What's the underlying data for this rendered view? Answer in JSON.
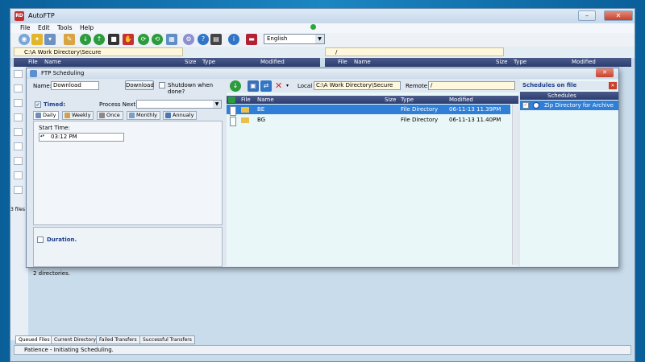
{
  "app": {
    "title": "AutoFTP",
    "icon_text": "RD"
  },
  "window_controls": {
    "minimize": "–",
    "maximize": "□",
    "close": "✕"
  },
  "menu": [
    "File",
    "Edit",
    "Tools",
    "Help"
  ],
  "language": {
    "selected": "English"
  },
  "paths": {
    "local": "C:\\A Work Directory\\Secure",
    "remote": "/"
  },
  "main_columns": {
    "left": [
      "File",
      "Name",
      "Size",
      "Type",
      "Modified"
    ],
    "right": [
      "File",
      "Name",
      "Size",
      "Type",
      "Modified"
    ]
  },
  "file_count": "3 files",
  "ftp": {
    "title": "FTP Scheduling",
    "name_label": "Name:",
    "name_value": "Download",
    "name_button": "Download",
    "shutdown_label": "Shutdown when done?",
    "timed_label": "Timed:",
    "process_next_label": "Process Next:",
    "sched_tabs": [
      "Daily",
      "Weekly",
      "Once",
      "Monthly",
      "Annualy"
    ],
    "start_time_label": "Start Time:",
    "start_time_value": "03:12 PM",
    "duration_label": "Duration.",
    "dirs_text": "2 directories.",
    "local_label": "Local",
    "local_value": "C:\\A Work Directory\\Secure",
    "remote_label": "Remote",
    "remote_value": "/",
    "columns": [
      "File",
      "Name",
      "Size",
      "Type",
      "Modified"
    ],
    "files": [
      {
        "name": "BE",
        "type": "File Directory",
        "modified": "06-11-13  11.39PM",
        "selected": true
      },
      {
        "name": "BG",
        "type": "File Directory",
        "modified": "06-11-13  11.40PM",
        "selected": false
      }
    ],
    "schedules_title": "Schedules on file",
    "schedules_header": "Schedules",
    "schedules": [
      "Zip Directory for Archive"
    ]
  },
  "bottom_tabs": [
    "Queued Files",
    "Current Directory",
    "Failed Transfers",
    "Successful Transfers"
  ],
  "status": "Patience - Initiating Scheduling.",
  "colors": {
    "header": "#2c3d70",
    "selection": "#2f7fd8",
    "accent": "#1d3f8a"
  }
}
